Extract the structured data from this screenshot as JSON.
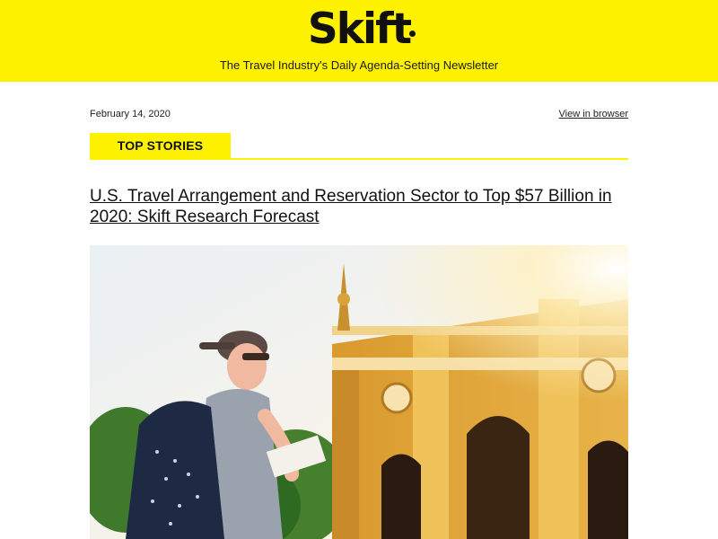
{
  "header": {
    "logo_text": "Skift",
    "tagline": "The Travel Industry's Daily Agenda-Setting Newsletter",
    "background_color": "#fff200"
  },
  "meta": {
    "date": "February 14, 2020",
    "view_in_browser": "View in browser"
  },
  "section": {
    "label": "TOP STORIES",
    "accent_color": "#fff200"
  },
  "story": {
    "headline": "U.S. Travel Arrangement and Reservation Sector to Top $57 Billion in 2020: Skift Research Forecast",
    "image_icon": "hero-photo-traveler-temple"
  }
}
